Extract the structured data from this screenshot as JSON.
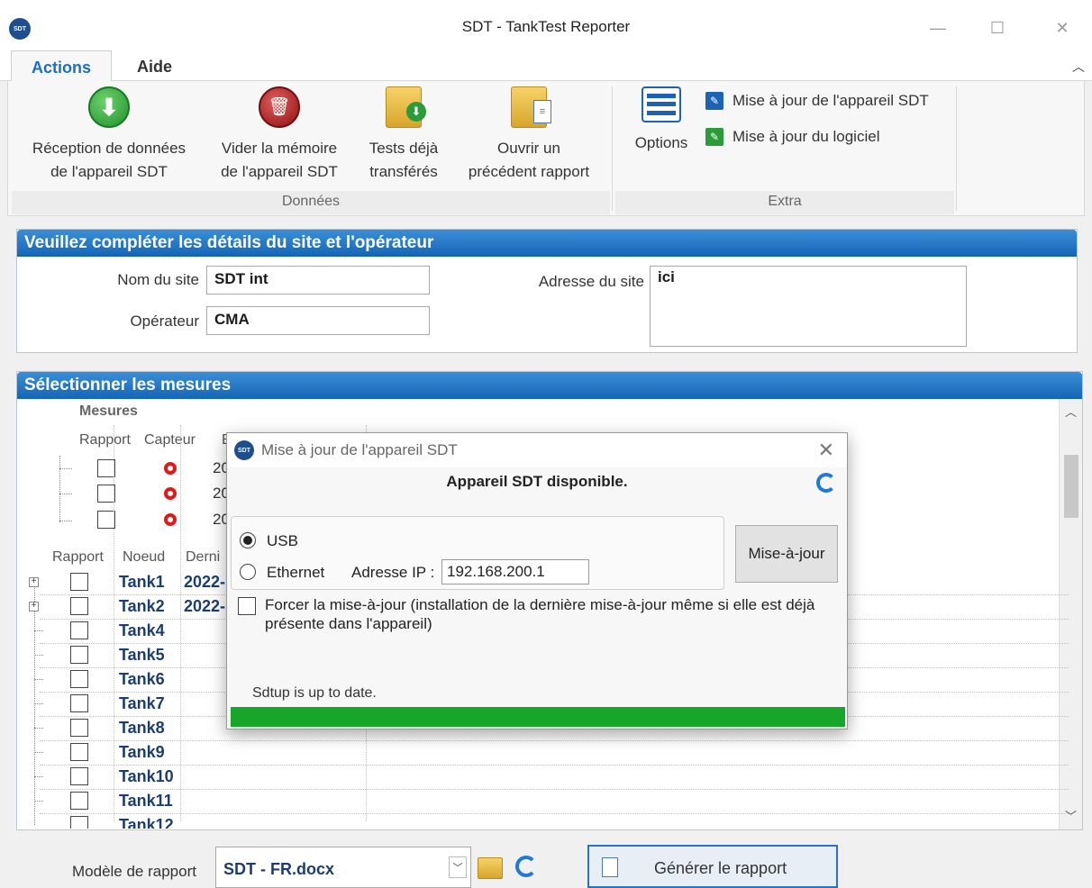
{
  "window": {
    "title": "SDT - TankTest Reporter",
    "logo_text": "SDT",
    "minimize": "—",
    "maximize": "☐",
    "close": "✕"
  },
  "ribbon": {
    "tabs": [
      {
        "label": "Actions",
        "active": true
      },
      {
        "label": "Aide",
        "active": false
      }
    ],
    "collapse_icon": "chevron-up-icon",
    "groups": {
      "donnees": {
        "label": "Données",
        "buttons": [
          {
            "line1": "Réception de données",
            "line2": "de l'appareil SDT",
            "icon": "download-icon"
          },
          {
            "line1": "Vider la mémoire",
            "line2": "de l'appareil SDT",
            "icon": "trash-icon"
          },
          {
            "line1": "Tests déjà",
            "line2": "transférés",
            "icon": "folder-download-icon"
          },
          {
            "line1": "Ouvrir un",
            "line2": "précédent rapport",
            "icon": "folder-document-icon"
          }
        ]
      },
      "extra": {
        "label": "Extra",
        "options_label": "Options",
        "links": [
          {
            "label": "Mise à jour de l'appareil SDT"
          },
          {
            "label": "Mise à jour du logiciel"
          }
        ]
      }
    }
  },
  "site_panel": {
    "header": "Veuillez compléter les détails du site et l'opérateur",
    "site_name_label": "Nom du site",
    "site_name_value": "SDT int",
    "operator_label": "Opérateur",
    "operator_value": "CMA",
    "address_label": "Adresse du site",
    "address_value": "ici"
  },
  "measures_panel": {
    "header": "Sélectionner les mesures",
    "sub_header": "Mesures",
    "sub_columns": [
      "Rapport",
      "Capteur",
      "E"
    ],
    "sub_rows_partial": [
      "20",
      "20",
      "20"
    ],
    "columns": [
      "Rapport",
      "Noeud",
      "Derni"
    ],
    "nodes": [
      {
        "name": "Tank1",
        "date": "2022-",
        "expandable": true
      },
      {
        "name": "Tank2",
        "date": "2022-",
        "expandable": true
      },
      {
        "name": "Tank4",
        "date": "",
        "expandable": false
      },
      {
        "name": "Tank5",
        "date": "",
        "expandable": false
      },
      {
        "name": "Tank6",
        "date": "",
        "expandable": false
      },
      {
        "name": "Tank7",
        "date": "",
        "expandable": false
      },
      {
        "name": "Tank8",
        "date": "",
        "expandable": false
      },
      {
        "name": "Tank9",
        "date": "",
        "expandable": false
      },
      {
        "name": "Tank10",
        "date": "",
        "expandable": false
      },
      {
        "name": "Tank11",
        "date": "",
        "expandable": false
      },
      {
        "name": "Tank12",
        "date": "",
        "expandable": false
      }
    ]
  },
  "dialog": {
    "title": "Mise à jour de l'appareil SDT",
    "logo_text": "SDT",
    "close": "✕",
    "status": "Appareil SDT disponible.",
    "usb_label": "USB",
    "usb_selected": true,
    "ethernet_label": "Ethernet",
    "ip_label": "Adresse IP :",
    "ip_value": "192.168.200.1",
    "update_button": "Mise-à-jour",
    "force_label": "Forcer la mise-à-jour (installation de la dernière mise-à-jour même si elle est déjà présente dans l'appareil)",
    "message": "Sdtup is up to date.",
    "progress_percent": 100,
    "progress_color": "#17a62a"
  },
  "bottom": {
    "template_label": "Modèle de rapport",
    "template_value": "SDT - FR.docx",
    "dropdown_arrow": "﹀",
    "generate_label": "Générer le rapport"
  },
  "colors": {
    "header_blue": "#1565b5",
    "accent_blue": "#1a6fc4",
    "node_text": "#1b3e6f"
  }
}
